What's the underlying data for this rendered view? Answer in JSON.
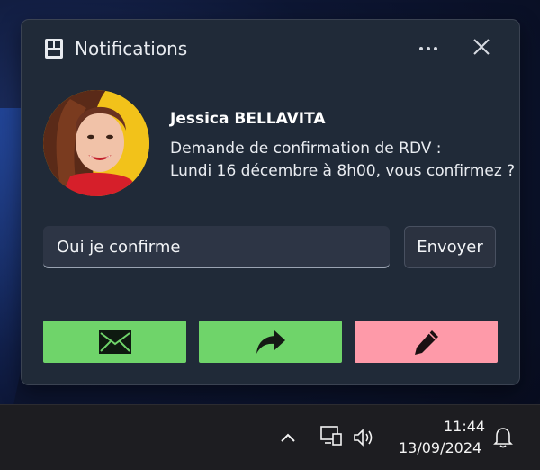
{
  "notification": {
    "title": "Notifications",
    "sender": "Jessica BELLAVITA",
    "message_line1": "Demande de confirmation de RDV :",
    "message_line2": "Lundi 16 décembre à 8h00, vous confirmez ?",
    "reply_value": "Oui je confirme",
    "send_label": "Envoyer",
    "actions": [
      {
        "icon": "envelope-icon",
        "color": "#6fd46a"
      },
      {
        "icon": "forward-arrow-icon",
        "color": "#6fd46a"
      },
      {
        "icon": "pencil-icon",
        "color": "#fe9aa9"
      }
    ]
  },
  "taskbar": {
    "time": "11:44",
    "date": "13/09/2024"
  }
}
